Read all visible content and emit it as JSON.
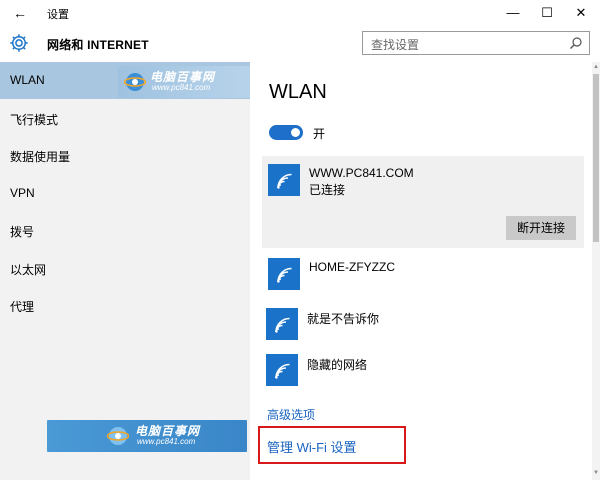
{
  "window": {
    "title": "设置",
    "back_glyph": "←",
    "minimize_glyph": "—",
    "maximize_glyph": "☐",
    "close_glyph": "✕"
  },
  "header": {
    "title": "网络和 INTERNET",
    "search_placeholder": "查找设置"
  },
  "sidebar": {
    "items": [
      {
        "label": "WLAN",
        "active": true
      },
      {
        "label": "飞行模式"
      },
      {
        "label": "数据使用量"
      },
      {
        "label": "VPN"
      },
      {
        "label": "拨号"
      },
      {
        "label": "以太网"
      },
      {
        "label": "代理"
      }
    ]
  },
  "watermark": {
    "name": "电脑百事网",
    "url": "www.pc841.com"
  },
  "main": {
    "title": "WLAN",
    "toggle_label": "开",
    "toggle_on": true,
    "networks": [
      {
        "name": "WWW.PC841.COM",
        "status": "已连接",
        "action": "断开连接"
      },
      {
        "name": "HOME-ZFYZZC"
      },
      {
        "name": "就是不告诉你"
      },
      {
        "name": "隐藏的网络"
      }
    ],
    "advanced_link": "高级选项",
    "manage_link": "管理 Wi-Fi 设置"
  },
  "colors": {
    "accent": "#1a73c8",
    "link": "#1a64c0",
    "sidebar_bg": "#f2f2f2",
    "selected_item": "#a8c6df",
    "highlight_border": "#d7191c"
  }
}
